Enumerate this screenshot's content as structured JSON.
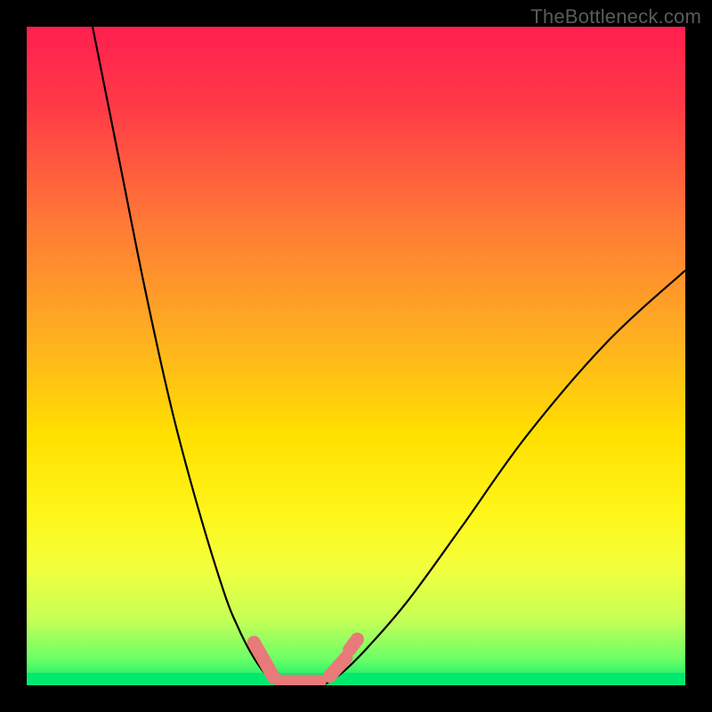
{
  "watermark": "TheBottleneck.com",
  "colors": {
    "gradient_stops": [
      {
        "offset": 0.0,
        "color": "#ff1f4f"
      },
      {
        "offset": 0.12,
        "color": "#ff3a47"
      },
      {
        "offset": 0.3,
        "color": "#ff7a36"
      },
      {
        "offset": 0.48,
        "color": "#ffb21f"
      },
      {
        "offset": 0.62,
        "color": "#ffe000"
      },
      {
        "offset": 0.74,
        "color": "#fff61a"
      },
      {
        "offset": 0.82,
        "color": "#f3ff3c"
      },
      {
        "offset": 0.9,
        "color": "#c6ff57"
      },
      {
        "offset": 0.96,
        "color": "#6cff66"
      },
      {
        "offset": 1.0,
        "color": "#00e96f"
      }
    ],
    "curve": "#000000",
    "marker": "#e87a79",
    "bg": "#000000",
    "bottom_strip": "#00e96f"
  },
  "chart_data": {
    "type": "line",
    "title": "",
    "xlabel": "",
    "ylabel": "",
    "xlim": [
      0,
      100
    ],
    "ylim": [
      0,
      100
    ],
    "series": [
      {
        "name": "left-curve",
        "x": [
          10,
          14,
          18,
          22,
          26,
          30,
          32,
          34,
          36,
          38
        ],
        "y": [
          100,
          80,
          60,
          42,
          27,
          14,
          9,
          5,
          2,
          0
        ]
      },
      {
        "name": "right-curve",
        "x": [
          45,
          48,
          52,
          58,
          66,
          76,
          88,
          100
        ],
        "y": [
          0,
          2,
          6,
          13,
          24,
          38,
          52,
          63
        ]
      },
      {
        "name": "trough",
        "x": [
          38,
          40,
          42,
          44,
          45
        ],
        "y": [
          0,
          0,
          0,
          0,
          0
        ]
      }
    ],
    "markers": [
      {
        "name": "trough-left-slope",
        "x": [
          34.5,
          37.5
        ],
        "y": [
          6.5,
          1.2
        ]
      },
      {
        "name": "trough-flat",
        "x": [
          38.5,
          44.5
        ],
        "y": [
          0.6,
          0.6
        ]
      },
      {
        "name": "trough-right-slope",
        "x": [
          46.0,
          48.5
        ],
        "y": [
          1.4,
          4.2
        ]
      },
      {
        "name": "trough-right-upper",
        "x": [
          49.0,
          50.2
        ],
        "y": [
          5.4,
          7.0
        ]
      }
    ],
    "annotations": []
  }
}
